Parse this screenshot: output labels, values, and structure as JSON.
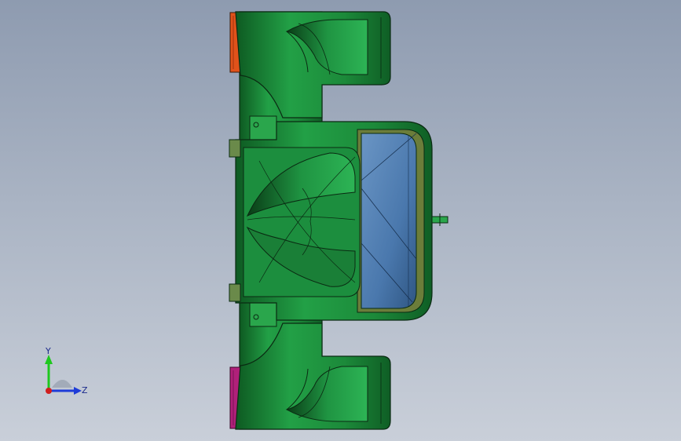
{
  "viewport": {
    "background_top": "#8e9bb0",
    "background_bottom": "#c9cfd9"
  },
  "model": {
    "body_color": "#1f8a3c",
    "edge_color": "#0a2a12",
    "canopy_color": "#4f7fb3",
    "left_wheel_color": "#e0521a",
    "right_wheel_color": "#b0207a"
  },
  "triad": {
    "y_label": "Y",
    "z_label": "Z",
    "y_color": "#1ec81e",
    "z_color": "#1e3cd8",
    "x_color": "#d01e1e"
  }
}
